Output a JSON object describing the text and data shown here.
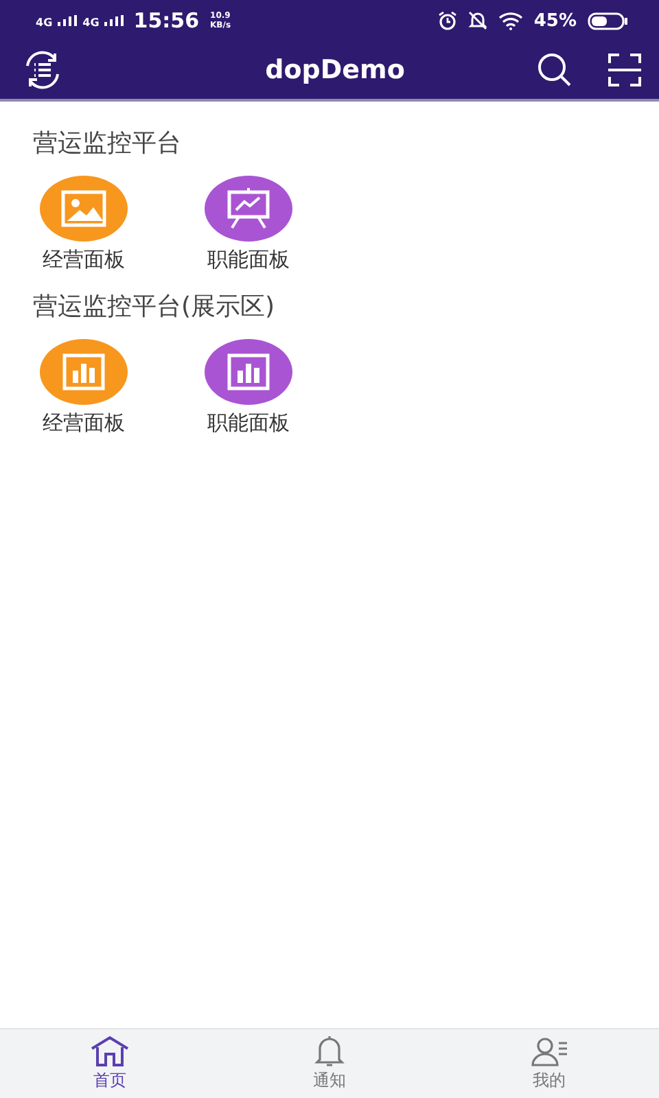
{
  "status_bar": {
    "network_1": "4G",
    "network_2": "4G",
    "time": "15:56",
    "speed_value": "10.9",
    "speed_unit": "KB/s",
    "battery": "45%"
  },
  "header": {
    "title": "dopDemo"
  },
  "sections": [
    {
      "title": "营运监控平台",
      "tiles": [
        {
          "label": "经营面板",
          "kind": "image",
          "color": "#f7971e"
        },
        {
          "label": "职能面板",
          "kind": "presentation",
          "color": "#a955d3"
        }
      ]
    },
    {
      "title": "营运监控平台(展示区)",
      "tiles": [
        {
          "label": "经营面板",
          "kind": "barchart",
          "color": "#f7971e"
        },
        {
          "label": "职能面板",
          "kind": "barchart",
          "color": "#a955d3"
        }
      ]
    }
  ],
  "tabs": [
    {
      "label": "首页",
      "kind": "home",
      "selected": true
    },
    {
      "label": "通知",
      "kind": "bell",
      "selected": false
    },
    {
      "label": "我的",
      "kind": "profile",
      "selected": false
    }
  ]
}
